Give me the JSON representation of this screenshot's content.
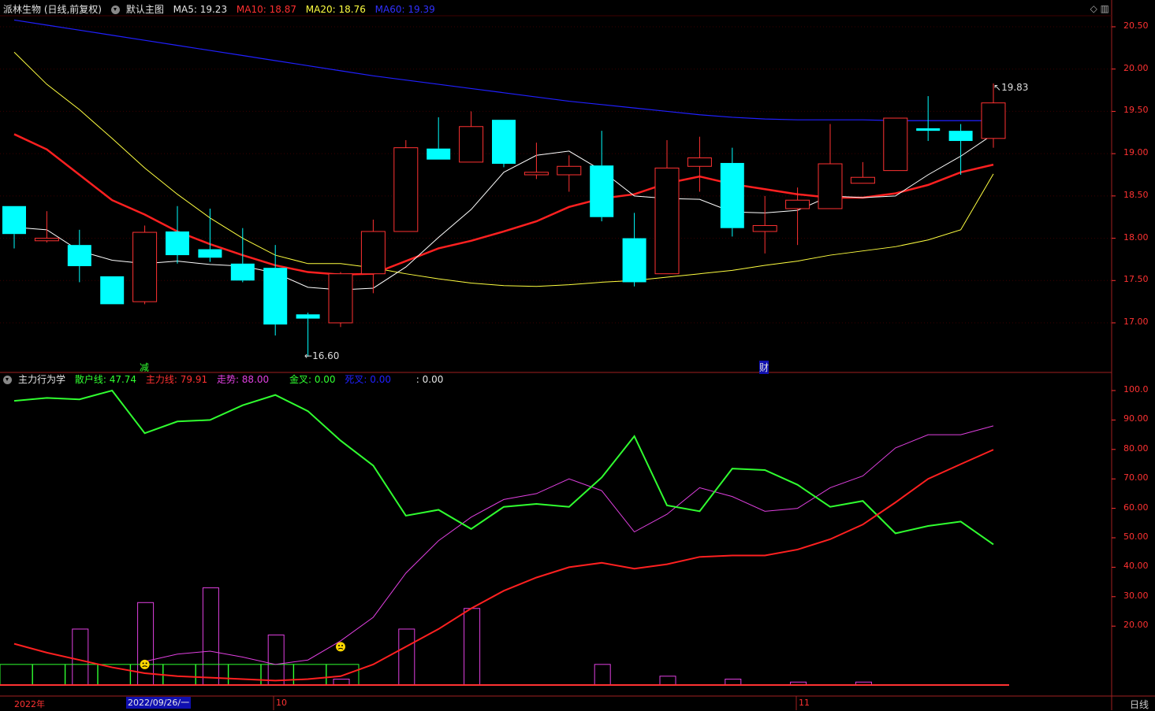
{
  "main_header": {
    "stock": "派林生物 (日线,前复权)",
    "template": "默认主图",
    "ma5": "MA5: 19.23",
    "ma10": "MA10: 18.87",
    "ma20": "MA20: 18.76",
    "ma60": "MA60: 19.39"
  },
  "sub_header": {
    "indicator": "主力行为学",
    "retail": "散户线: 47.74",
    "main_force": "主力线: 79.91",
    "trend": "走势: 88.00",
    "golden": "金叉: 0.00",
    "death": "死叉: 0.00",
    "blank": ": 0.00"
  },
  "annotations": {
    "high": "19.83",
    "low": "16.60",
    "event1": "减",
    "event2": "财"
  },
  "price_axis": [
    "20.50",
    "20.00",
    "19.50",
    "19.00",
    "18.50",
    "18.00",
    "17.50",
    "17.00"
  ],
  "ind_axis": [
    "100.0",
    "90.00",
    "80.00",
    "70.00",
    "60.00",
    "50.00",
    "40.00",
    "30.00",
    "20.00"
  ],
  "x_axis": {
    "year": "2022年",
    "selected": "2022/09/26/一",
    "oct": "10",
    "nov": "11",
    "period": "日线"
  },
  "colors": {
    "up": "#ff3232",
    "down": "#00ffff",
    "ma5": "#ffffff",
    "ma10": "#ff2020",
    "ma20": "#ffff40",
    "ma60": "#2020ff",
    "retail": "#30ff30",
    "mainforce": "#ff2020",
    "trend": "#e040e0"
  },
  "chart_data": {
    "type": "candlestick",
    "candles": [
      {
        "o": 18.38,
        "h": 18.38,
        "l": 17.88,
        "c": 18.05
      },
      {
        "o": 17.97,
        "h": 18.32,
        "l": 17.95,
        "c": 18.0
      },
      {
        "o": 17.92,
        "h": 18.1,
        "l": 17.48,
        "c": 17.67
      },
      {
        "o": 17.55,
        "h": 17.55,
        "l": 17.22,
        "c": 17.22
      },
      {
        "o": 17.25,
        "h": 18.15,
        "l": 17.22,
        "c": 18.07
      },
      {
        "o": 18.08,
        "h": 18.38,
        "l": 17.7,
        "c": 17.8
      },
      {
        "o": 17.87,
        "h": 18.35,
        "l": 17.72,
        "c": 17.77
      },
      {
        "o": 17.7,
        "h": 18.12,
        "l": 17.48,
        "c": 17.5
      },
      {
        "o": 17.65,
        "h": 17.92,
        "l": 16.85,
        "c": 16.98
      },
      {
        "o": 17.1,
        "h": 17.12,
        "l": 16.6,
        "c": 17.05
      },
      {
        "o": 17.0,
        "h": 17.6,
        "l": 16.95,
        "c": 17.58
      },
      {
        "o": 17.58,
        "h": 18.22,
        "l": 17.35,
        "c": 18.08
      },
      {
        "o": 18.08,
        "h": 19.16,
        "l": 18.08,
        "c": 19.07
      },
      {
        "o": 19.06,
        "h": 19.43,
        "l": 18.93,
        "c": 18.93
      },
      {
        "o": 18.9,
        "h": 19.5,
        "l": 18.9,
        "c": 19.32
      },
      {
        "o": 19.4,
        "h": 19.4,
        "l": 18.84,
        "c": 18.88
      },
      {
        "o": 18.75,
        "h": 19.13,
        "l": 18.7,
        "c": 18.78
      },
      {
        "o": 18.75,
        "h": 18.98,
        "l": 18.55,
        "c": 18.85
      },
      {
        "o": 18.86,
        "h": 19.27,
        "l": 18.2,
        "c": 18.25
      },
      {
        "o": 18.0,
        "h": 18.3,
        "l": 17.43,
        "c": 17.48
      },
      {
        "o": 17.58,
        "h": 19.16,
        "l": 17.58,
        "c": 18.83
      },
      {
        "o": 18.85,
        "h": 19.2,
        "l": 18.55,
        "c": 18.95
      },
      {
        "o": 18.89,
        "h": 19.07,
        "l": 18.02,
        "c": 18.12
      },
      {
        "o": 18.08,
        "h": 18.5,
        "l": 17.82,
        "c": 18.15
      },
      {
        "o": 18.35,
        "h": 18.6,
        "l": 17.92,
        "c": 18.45
      },
      {
        "o": 18.35,
        "h": 19.35,
        "l": 18.35,
        "c": 18.88
      },
      {
        "o": 18.65,
        "h": 18.9,
        "l": 18.65,
        "c": 18.72
      },
      {
        "o": 18.8,
        "h": 19.42,
        "l": 18.8,
        "c": 19.42
      },
      {
        "o": 19.3,
        "h": 19.68,
        "l": 19.15,
        "c": 19.27
      },
      {
        "o": 19.27,
        "h": 19.35,
        "l": 18.75,
        "c": 19.15
      },
      {
        "o": 19.18,
        "h": 19.83,
        "l": 19.07,
        "c": 19.6
      }
    ],
    "ma5": [
      18.13,
      18.1,
      17.85,
      17.74,
      17.7,
      17.73,
      17.69,
      17.67,
      17.59,
      17.42,
      17.39,
      17.41,
      17.66,
      18.01,
      18.34,
      18.78,
      18.98,
      19.03,
      18.8,
      18.5,
      18.47,
      18.46,
      18.31,
      18.3,
      18.33,
      18.5,
      18.48,
      18.5,
      18.75,
      18.97,
      19.23
    ],
    "ma10": [
      19.23,
      19.05,
      18.75,
      18.45,
      18.28,
      18.08,
      17.93,
      17.8,
      17.68,
      17.6,
      17.57,
      17.58,
      17.73,
      17.88,
      17.97,
      18.08,
      18.2,
      18.37,
      18.47,
      18.52,
      18.65,
      18.73,
      18.64,
      18.58,
      18.52,
      18.48,
      18.48,
      18.53,
      18.63,
      18.78,
      18.87
    ],
    "ma20": [
      20.2,
      19.82,
      19.52,
      19.18,
      18.83,
      18.52,
      18.24,
      18.0,
      17.8,
      17.7,
      17.7,
      17.65,
      17.58,
      17.52,
      17.47,
      17.44,
      17.43,
      17.45,
      17.48,
      17.5,
      17.54,
      17.58,
      17.62,
      17.68,
      17.73,
      17.8,
      17.85,
      17.9,
      17.98,
      18.1,
      18.76
    ],
    "ma60": [
      20.58,
      20.52,
      20.46,
      20.4,
      20.34,
      20.28,
      20.22,
      20.16,
      20.1,
      20.04,
      19.98,
      19.92,
      19.87,
      19.82,
      19.77,
      19.72,
      19.67,
      19.62,
      19.58,
      19.54,
      19.5,
      19.46,
      19.43,
      19.41,
      19.4,
      19.4,
      19.4,
      19.39,
      19.39,
      19.39,
      19.39
    ],
    "retail": [
      96.5,
      97.5,
      97.0,
      100.0,
      85.5,
      89.5,
      90.0,
      95.0,
      98.5,
      93.0,
      83.0,
      74.5,
      57.5,
      59.5,
      53.0,
      60.5,
      61.5,
      60.5,
      70.5,
      84.5,
      61.0,
      59.0,
      73.5,
      73.0,
      68.0,
      60.5,
      62.5,
      51.5,
      54.0,
      55.5,
      47.74
    ],
    "main_force": [
      14.0,
      11.0,
      8.5,
      6.0,
      4.0,
      3.0,
      2.5,
      2.0,
      1.5,
      2.0,
      3.0,
      7.0,
      13.0,
      19.0,
      26.0,
      32.0,
      36.5,
      40.0,
      41.5,
      39.5,
      41.0,
      43.5,
      44.0,
      44.0,
      46.0,
      49.5,
      54.5,
      62.0,
      70.0,
      75.0,
      79.91
    ],
    "trend": [
      null,
      null,
      null,
      null,
      8.0,
      10.5,
      11.5,
      9.5,
      7.0,
      8.5,
      15.0,
      23.0,
      38.0,
      49.0,
      57.0,
      63.0,
      65.0,
      70.0,
      66.0,
      52.0,
      58.0,
      67.0,
      64.0,
      59.0,
      60.0,
      67.0,
      71.0,
      80.5,
      85.0,
      85.0,
      88.0
    ],
    "bars": [
      0,
      0,
      19,
      0,
      28,
      0,
      33,
      0,
      17,
      0,
      2,
      0,
      19,
      0,
      26,
      0,
      0,
      0,
      7,
      0,
      3,
      0,
      2,
      0,
      1,
      0,
      1,
      0,
      0,
      0,
      0
    ]
  }
}
